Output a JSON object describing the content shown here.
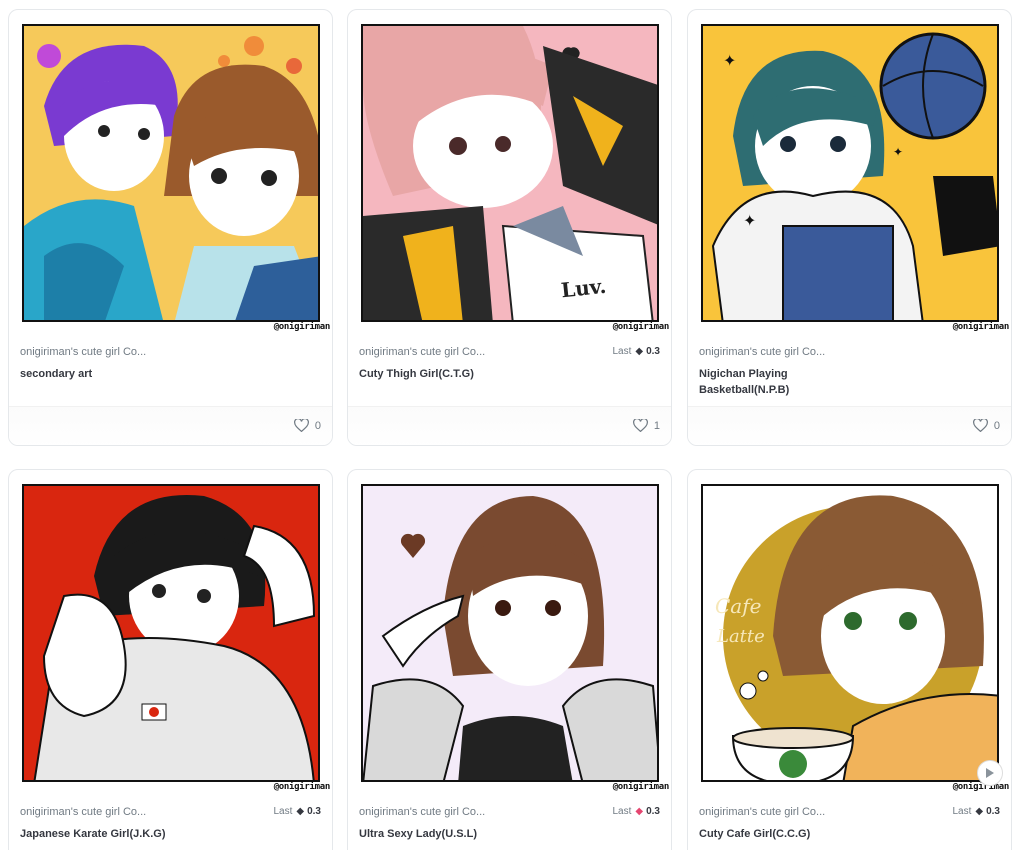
{
  "credit": "@onigiriman",
  "cards": [
    {
      "collection": "onigiriman's cute girl Co...",
      "title": "secondary art",
      "price_label": "",
      "price": "",
      "likes": "0",
      "palette": {
        "bg": "#f7c94b",
        "accent": "#7a3ad1",
        "hair": "#9a5a2c",
        "cloth": "#29a6c9"
      }
    },
    {
      "collection": "onigiriman's cute girl Co...",
      "title": "Cuty Thigh Girl(C.T.G)",
      "price_label": "Last",
      "price": "0.3",
      "likes": "1",
      "palette": {
        "bg": "#f5b7bf",
        "accent": "#2a2a2a",
        "hair": "#e8a6a6",
        "cloth": "#f0b21c"
      }
    },
    {
      "collection": "onigiriman's cute girl Co...",
      "title": "Nigichan Playing Basketball(N.P.B)",
      "price_label": "",
      "price": "",
      "likes": "0",
      "palette": {
        "bg": "#f9c43b",
        "accent": "#3a5a9a",
        "hair": "#2e6d72",
        "cloth": "#f3f3f3"
      }
    },
    {
      "collection": "onigiriman's cute girl Co...",
      "title": "Japanese Karate Girl(J.K.G)",
      "price_label": "Last",
      "price": "0.3",
      "likes": "",
      "palette": {
        "bg": "#d9260f",
        "accent": "#111111",
        "hair": "#1a1a1a",
        "cloth": "#e8e8e8"
      }
    },
    {
      "collection": "onigiriman's cute girl Co...",
      "title": "Ultra Sexy Lady(U.S.L)",
      "price_label": "Last",
      "price": "0.3",
      "likes": "",
      "palette": {
        "bg": "#f4ebf9",
        "accent": "#6b3a25",
        "hair": "#7a4a30",
        "cloth": "#d9d9d9"
      }
    },
    {
      "collection": "onigiriman's cute girl Co...",
      "title": "Cuty Cafe Girl(C.C.G)",
      "price_label": "Last",
      "price": "0.3",
      "likes": "",
      "palette": {
        "bg": "#ffffff",
        "accent": "#c9a12a",
        "hair": "#8a5a34",
        "cloth": "#f1b35a"
      }
    }
  ],
  "art_text": {
    "luv": "Luv.",
    "cafe": "Cafe",
    "latte": "Latte"
  }
}
